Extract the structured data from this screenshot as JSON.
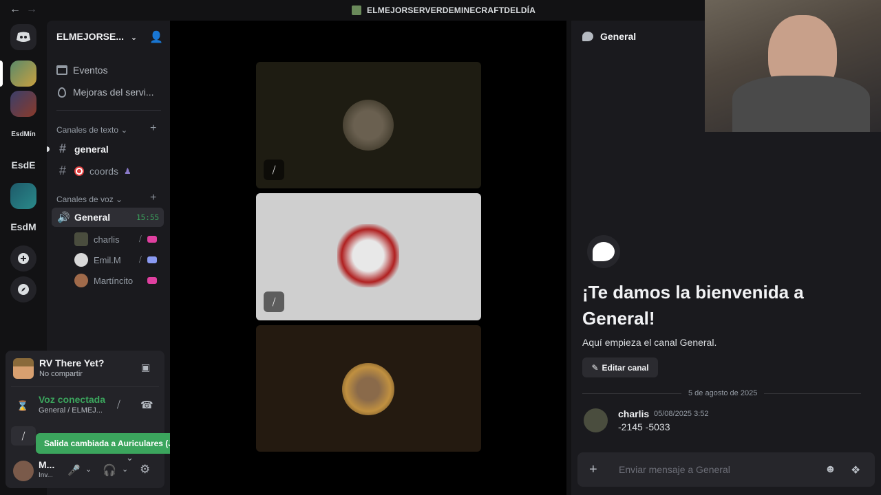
{
  "titlebar": {
    "title": "ELMEJORSERVERDEMINECRAFTDELDÍA",
    "back_icon": "←",
    "forward_icon": "→"
  },
  "rail": {
    "home_icon": "discord-logo",
    "items": [
      "EsdMín",
      "EsdE",
      "EsdM"
    ]
  },
  "sidebar": {
    "server_name": "ELMEJORSE...",
    "events": "Eventos",
    "boosts": "Mejoras del servi...",
    "text_category": "Canales de texto",
    "text_channels": [
      "general",
      "coords"
    ],
    "voice_category": "Canales de voz",
    "voice_channel": {
      "name": "General",
      "timer": "15:55"
    },
    "members": [
      "charlis",
      "Emil.M",
      "Martíncito"
    ]
  },
  "panel": {
    "game_title": "RV There Yet?",
    "game_status": "No compartir",
    "voice_status": "Voz conectada",
    "voice_location": "General / ELMEJ...",
    "user_name": "M...",
    "user_status": "Inv...",
    "toast": "Salida cambiada a Auriculares (JBL Tun..."
  },
  "chat": {
    "channel": "General",
    "welcome": "¡Te damos la bienvenida a General!",
    "start_text": "Aquí empieza el canal General.",
    "edit_label": "Editar canal",
    "date_divider": "5 de agosto de 2025",
    "message": {
      "user": "charlis",
      "time": "05/08/2025 3:52",
      "text": "-2145 -5033"
    },
    "composer_placeholder": "Enviar mensaje a General"
  },
  "colors": {
    "online_green": "#3ba55d",
    "accent": "#5865f2",
    "bg": "#121214"
  }
}
